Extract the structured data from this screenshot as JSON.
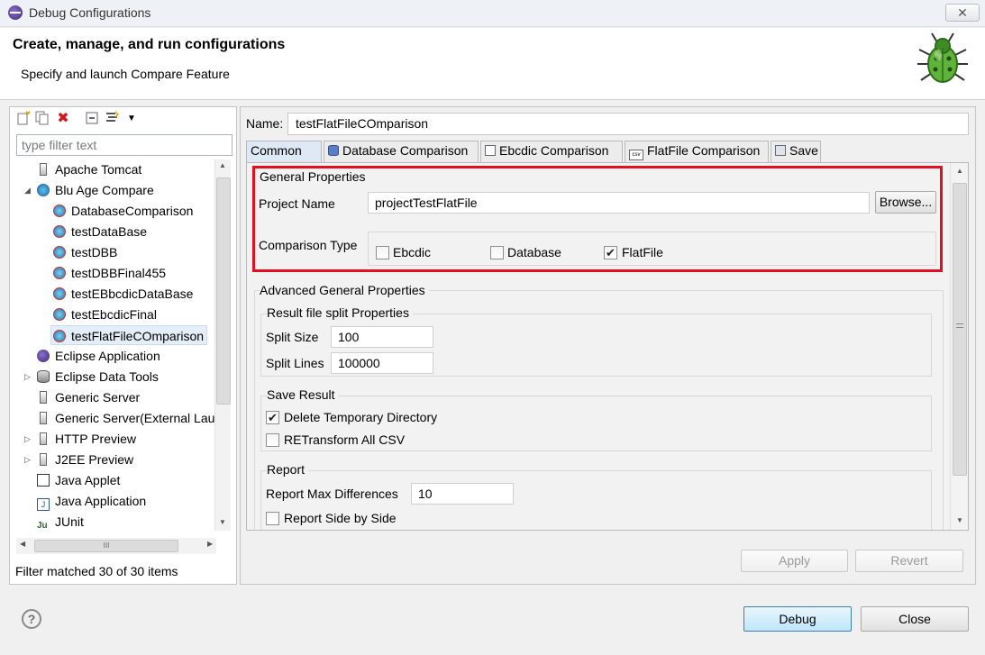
{
  "window": {
    "title": "Debug Configurations",
    "close_glyph": "✕"
  },
  "header": {
    "title": "Create, manage, and run configurations",
    "subtitle": "Specify and launch  Compare Feature"
  },
  "left": {
    "toolbar_icons": [
      "new-configuration-icon",
      "duplicate-icon",
      "delete-icon",
      "collapse-all-icon",
      "filter-icon",
      "view-menu-icon"
    ],
    "filter_placeholder": "type filter text",
    "tree": [
      {
        "label": "Apache Tomcat",
        "icon": "server-icon",
        "level": 0
      },
      {
        "label": "Blu Age Compare",
        "icon": "compare-icon",
        "level": 0,
        "expanded": true
      },
      {
        "label": "DatabaseComparison",
        "icon": "compare-config-icon",
        "level": 1
      },
      {
        "label": "testDataBase",
        "icon": "compare-config-icon",
        "level": 1
      },
      {
        "label": "testDBB",
        "icon": "compare-config-icon",
        "level": 1
      },
      {
        "label": "testDBBFinal455",
        "icon": "compare-config-icon",
        "level": 1
      },
      {
        "label": "testEBbcdicDataBase",
        "icon": "compare-config-icon",
        "level": 1
      },
      {
        "label": "testEbcdicFinal",
        "icon": "compare-config-icon",
        "level": 1
      },
      {
        "label": "testFlatFileCOmparison",
        "icon": "compare-config-icon",
        "level": 1,
        "selected": true
      },
      {
        "label": "Eclipse Application",
        "icon": "eclipse-icon",
        "level": 0
      },
      {
        "label": "Eclipse Data Tools",
        "icon": "database-icon",
        "level": 0,
        "collapsed": true
      },
      {
        "label": "Generic Server",
        "icon": "server-icon",
        "level": 0
      },
      {
        "label": "Generic Server(External Lau",
        "icon": "server-icon",
        "level": 0
      },
      {
        "label": "HTTP Preview",
        "icon": "server-icon",
        "level": 0,
        "collapsed": true
      },
      {
        "label": "J2EE Preview",
        "icon": "server-icon",
        "level": 0,
        "collapsed": true
      },
      {
        "label": "Java Applet",
        "icon": "applet-icon",
        "level": 0
      },
      {
        "label": "Java Application",
        "icon": "java-app-icon",
        "level": 0
      },
      {
        "label": "JUnit",
        "icon": "junit-icon",
        "level": 0
      }
    ],
    "hscroll_grip": "III",
    "filter_message": "Filter matched 30 of 30 items"
  },
  "right": {
    "name_label": "Name:",
    "name_value": "testFlatFileCOmparison",
    "tabs": [
      {
        "label": "Common",
        "active": true
      },
      {
        "label": "Database Comparison",
        "icon": "database-tab-icon"
      },
      {
        "label": "Ebcdic Comparison",
        "icon": "document-tab-icon"
      },
      {
        "label": "FlatFile Comparison",
        "icon": "csv-tab-icon"
      },
      {
        "label": "Save",
        "icon": "save-tab-icon"
      }
    ],
    "general": {
      "title": "General Properties",
      "project_label": "Project Name",
      "project_value": "projectTestFlatFile",
      "browse_label": "Browse...",
      "comparison_label": "Comparison Type",
      "options": [
        {
          "label": "Ebcdic",
          "checked": false
        },
        {
          "label": "Database",
          "checked": false
        },
        {
          "label": "FlatFile",
          "checked": true
        }
      ]
    },
    "advanced": {
      "title": "Advanced General Properties",
      "split_title": "Result file split Properties",
      "split_size_label": "Split Size",
      "split_size_value": "100",
      "split_lines_label": "Split Lines",
      "split_lines_value": "100000",
      "save_title": "Save Result",
      "delete_temp_label": "Delete Temporary Directory",
      "delete_temp_checked": true,
      "retransform_label": "RETransform All CSV",
      "retransform_checked": false,
      "report_title": "Report",
      "report_max_label": "Report Max Differences",
      "report_max_value": "10",
      "report_side_label": "Report Side by Side",
      "report_side_checked": false
    },
    "apply_label": "Apply",
    "revert_label": "Revert"
  },
  "footer": {
    "help_glyph": "?",
    "debug_label": "Debug",
    "close_label": "Close"
  },
  "colors": {
    "highlight_border": "#e0101e",
    "selection": "#e3eef9",
    "default_button": "#bee6fd"
  }
}
